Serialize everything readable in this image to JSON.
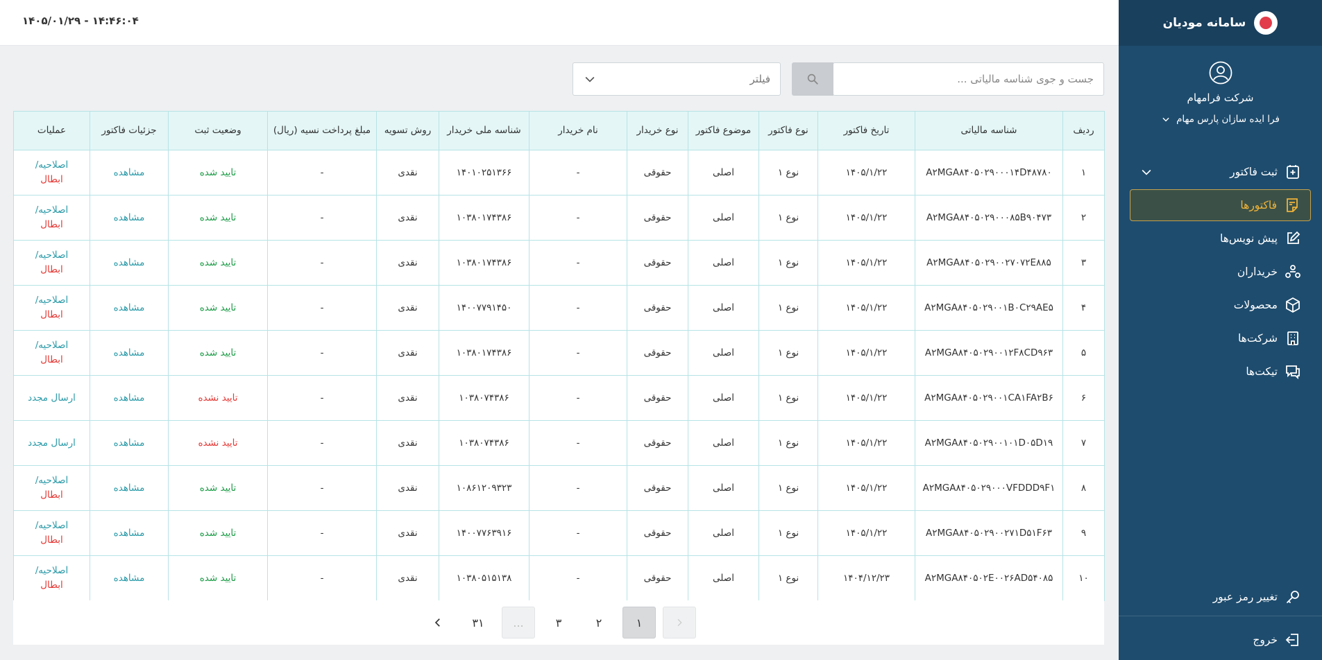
{
  "sidebar": {
    "brand": "سامانه مودیان",
    "company": "شرکت فرامهام",
    "subcompany": "فرا ایده سازان پارس مهام",
    "menu": [
      {
        "label": "ثبت فاکتور",
        "icon": "invoice-add-icon"
      },
      {
        "label": "فاکتورها",
        "icon": "invoices-icon",
        "active": true
      },
      {
        "label": "پیش نویس‌ها",
        "icon": "edit-icon"
      },
      {
        "label": "خریداران",
        "icon": "buyers-icon"
      },
      {
        "label": "محصولات",
        "icon": "box-icon"
      },
      {
        "label": "شرکت‌ها",
        "icon": "building-icon"
      },
      {
        "label": "تیکت‌ها",
        "icon": "chat-icon"
      }
    ],
    "change_password": "تغییر رمز عبور",
    "logout": "خروج"
  },
  "topbar": {
    "datetime": "۱۴۰۵/۰۱/۲۹ - ۱۴:۴۶:۰۴"
  },
  "search": {
    "placeholder": "جست و جوی شناسه مالیاتی ..."
  },
  "filter": {
    "label": "فیلتر"
  },
  "table": {
    "headers": [
      "ردیف",
      "شناسه مالیاتی",
      "تاریخ فاکتور",
      "نوع فاکتور",
      "موضوع فاکتور",
      "نوع خریدار",
      "نام خریدار",
      "شناسه ملی خریدار",
      "روش تسویه",
      "مبلغ پرداخت نسیه (ریال)",
      "وضعیت ثبت",
      "جزئیات فاکتور",
      "عملیات"
    ],
    "rows": [
      {
        "n": "۱",
        "tax_id": "A۲MGA۸۴۰۵۰۲۹۰۰۰۱۴D۴۸۷۸۰",
        "date": "۱۴۰۵/۱/۲۲",
        "type": "نوع ۱",
        "subject": "اصلی",
        "buyer_type": "حقوقی",
        "buyer_name": "-",
        "national_id": "۱۴۰۱۰۲۵۱۳۶۶",
        "settlement": "نقدی",
        "credit": "-",
        "status": "تایید شده",
        "ok": true,
        "details": "مشاهده",
        "op1": "اصلاحیه/",
        "op2": "ابطال"
      },
      {
        "n": "۲",
        "tax_id": "A۲MGA۸۴۰۵۰۲۹۰۰۰۸۵B۹۰۴۷۳",
        "date": "۱۴۰۵/۱/۲۲",
        "type": "نوع ۱",
        "subject": "اصلی",
        "buyer_type": "حقوقی",
        "buyer_name": "-",
        "national_id": "۱۰۳۸۰۱۷۴۳۸۶",
        "settlement": "نقدی",
        "credit": "-",
        "status": "تایید شده",
        "ok": true,
        "details": "مشاهده",
        "op1": "اصلاحیه/",
        "op2": "ابطال"
      },
      {
        "n": "۳",
        "tax_id": "A۲MGA۸۴۰۵۰۲۹۰۰۲۷۰۷۲E۸۸۵",
        "date": "۱۴۰۵/۱/۲۲",
        "type": "نوع ۱",
        "subject": "اصلی",
        "buyer_type": "حقوقی",
        "buyer_name": "-",
        "national_id": "۱۰۳۸۰۱۷۴۳۸۶",
        "settlement": "نقدی",
        "credit": "-",
        "status": "تایید شده",
        "ok": true,
        "details": "مشاهده",
        "op1": "اصلاحیه/",
        "op2": "ابطال"
      },
      {
        "n": "۴",
        "tax_id": "A۲MGA۸۴۰۵۰۲۹۰۰۱B۰C۲۹AE۵",
        "date": "۱۴۰۵/۱/۲۲",
        "type": "نوع ۱",
        "subject": "اصلی",
        "buyer_type": "حقوقی",
        "buyer_name": "-",
        "national_id": "۱۴۰۰۷۷۹۱۴۵۰",
        "settlement": "نقدی",
        "credit": "-",
        "status": "تایید شده",
        "ok": true,
        "details": "مشاهده",
        "op1": "اصلاحیه/",
        "op2": "ابطال"
      },
      {
        "n": "۵",
        "tax_id": "A۲MGA۸۴۰۵۰۲۹۰۰۱۲F۸CD۹۶۳",
        "date": "۱۴۰۵/۱/۲۲",
        "type": "نوع ۱",
        "subject": "اصلی",
        "buyer_type": "حقوقی",
        "buyer_name": "-",
        "national_id": "۱۰۳۸۰۱۷۴۳۸۶",
        "settlement": "نقدی",
        "credit": "-",
        "status": "تایید شده",
        "ok": true,
        "details": "مشاهده",
        "op1": "اصلاحیه/",
        "op2": "ابطال"
      },
      {
        "n": "۶",
        "tax_id": "A۲MGA۸۴۰۵۰۲۹۰۰۱CA۱FA۲B۶",
        "date": "۱۴۰۵/۱/۲۲",
        "type": "نوع ۱",
        "subject": "اصلی",
        "buyer_type": "حقوقی",
        "buyer_name": "-",
        "national_id": "۱۰۳۸۰۷۴۳۸۶",
        "settlement": "نقدی",
        "credit": "-",
        "status": "تایید نشده",
        "ok": false,
        "details": "مشاهده",
        "op1": "ارسال مجدد",
        "op2": ""
      },
      {
        "n": "۷",
        "tax_id": "A۲MGA۸۴۰۵۰۲۹۰۰۱۰۱D۰۵D۱۹",
        "date": "۱۴۰۵/۱/۲۲",
        "type": "نوع ۱",
        "subject": "اصلی",
        "buyer_type": "حقوقی",
        "buyer_name": "-",
        "national_id": "۱۰۳۸۰۷۴۳۸۶",
        "settlement": "نقدی",
        "credit": "-",
        "status": "تایید نشده",
        "ok": false,
        "details": "مشاهده",
        "op1": "ارسال مجدد",
        "op2": ""
      },
      {
        "n": "۸",
        "tax_id": "A۲MGA۸۴۰۵۰۲۹۰۰۰VFDDD۹F۱",
        "date": "۱۴۰۵/۱/۲۲",
        "type": "نوع ۱",
        "subject": "اصلی",
        "buyer_type": "حقوقی",
        "buyer_name": "-",
        "national_id": "۱۰۸۶۱۲۰۹۳۲۳",
        "settlement": "نقدی",
        "credit": "-",
        "status": "تایید شده",
        "ok": true,
        "details": "مشاهده",
        "op1": "اصلاحیه/",
        "op2": "ابطال"
      },
      {
        "n": "۹",
        "tax_id": "A۲MGA۸۴۰۵۰۲۹۰۰۲۷۱D۵۱F۶۳",
        "date": "۱۴۰۵/۱/۲۲",
        "type": "نوع ۱",
        "subject": "اصلی",
        "buyer_type": "حقوقی",
        "buyer_name": "-",
        "national_id": "۱۴۰۰۷۷۶۳۹۱۶",
        "settlement": "نقدی",
        "credit": "-",
        "status": "تایید شده",
        "ok": true,
        "details": "مشاهده",
        "op1": "اصلاحیه/",
        "op2": "ابطال"
      },
      {
        "n": "۱۰",
        "tax_id": "A۲MGA۸۴۰۵۰۲E۰۰۲۶AD۵۴۰۸۵",
        "date": "۱۴۰۴/۱۲/۲۳",
        "type": "نوع ۱",
        "subject": "اصلی",
        "buyer_type": "حقوقی",
        "buyer_name": "-",
        "national_id": "۱۰۳۸۰۵۱۵۱۳۸",
        "settlement": "نقدی",
        "credit": "-",
        "status": "تایید شده",
        "ok": true,
        "details": "مشاهده",
        "op1": "اصلاحیه/",
        "op2": "ابطال"
      }
    ]
  },
  "pagination": {
    "pages": [
      {
        "label": "",
        "kind": "prev-disabled"
      },
      {
        "label": "۱",
        "kind": "active"
      },
      {
        "label": "۲",
        "kind": "normal"
      },
      {
        "label": "۳",
        "kind": "normal"
      },
      {
        "label": "...",
        "kind": "ellipsis"
      },
      {
        "label": "۳۱",
        "kind": "normal"
      }
    ]
  },
  "colors": {
    "sidebar": "#1e4c6e",
    "accent": "#f0b338",
    "success": "#1a9b45",
    "danger": "#e53935",
    "link": "#2a9aa8"
  }
}
